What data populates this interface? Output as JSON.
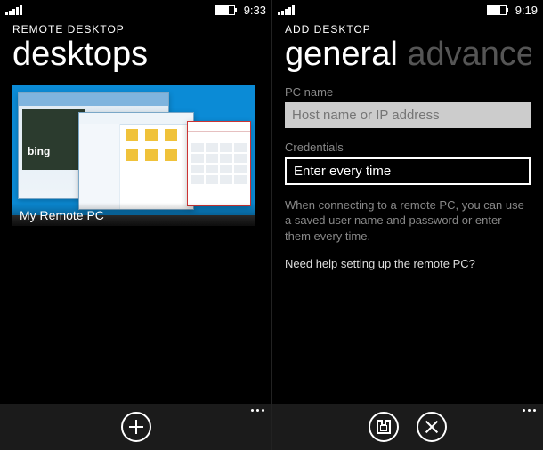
{
  "left": {
    "status": {
      "time": "9:33"
    },
    "app_name": "REMOTE DESKTOP",
    "page_title": "desktops",
    "tile": {
      "label": "My Remote PC",
      "preview_hint": "bing"
    },
    "appbar": {
      "add_label": "add"
    }
  },
  "right": {
    "status": {
      "time": "9:19"
    },
    "app_name": "ADD DESKTOP",
    "tabs": {
      "active": "general",
      "inactive": "advance"
    },
    "form": {
      "pc_name_label": "PC name",
      "pc_name_placeholder": "Host name or IP address",
      "pc_name_value": "",
      "credentials_label": "Credentials",
      "credentials_value": "Enter every time",
      "help_text": "When connecting to a remote PC, you can use a saved user name and password or enter them every time.",
      "help_link": "Need help setting up the remote PC?"
    },
    "appbar": {
      "save_label": "save",
      "cancel_label": "cancel"
    }
  }
}
